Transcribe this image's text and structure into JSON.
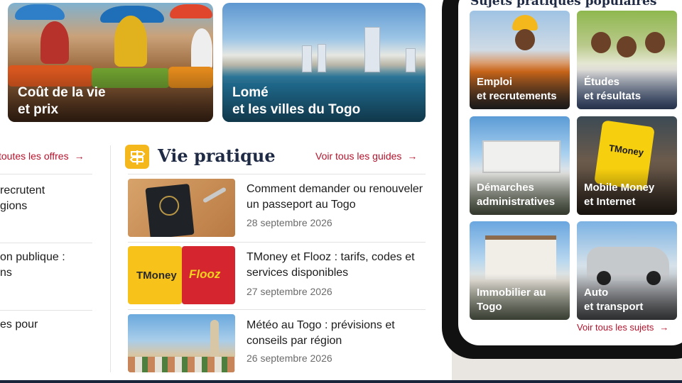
{
  "hero": {
    "market_title_line1": "Coût de la vie",
    "market_title_line2": "et prix",
    "lome_title_line1": "Lomé",
    "lome_title_line2": "et les villes du Togo"
  },
  "left_column": {
    "link": "toutes les offres",
    "item1_line1": "recrutent",
    "item1_line2": "gions",
    "item2_line1": "on publique :",
    "item2_line2": "ns",
    "item3_line1": "es pour"
  },
  "vie_pratique": {
    "title": "Vie pratique",
    "see_all": "Voir tous les guides",
    "articles": [
      {
        "title": "Comment demander ou renouveler un passeport au Togo",
        "date": "28 septembre 2026"
      },
      {
        "title": "TMoney et Flooz : tarifs, codes et services disponibles",
        "date": "27 septembre 2026"
      },
      {
        "title": "Météo au Togo : prévisions et conseils par région",
        "date": "26 septembre 2026"
      }
    ],
    "thumb_tmoney": "TMoney",
    "thumb_flooz": "Flooz"
  },
  "phone": {
    "heading": "Sujets pratiques populaires",
    "tiles": [
      {
        "line1": "Emploi",
        "line2": "et recrutements"
      },
      {
        "line1": "Études",
        "line2": "et résultats"
      },
      {
        "line1": "Démarches",
        "line2": "administratives"
      },
      {
        "line1": "Mobile Money",
        "line2": "et Internet"
      },
      {
        "line1": "Immobilier au Togo",
        "line2": ""
      },
      {
        "line1": "Auto",
        "line2": "et transport"
      }
    ],
    "mobile_screen_text": "TMoney",
    "see_all": "Voir tous les sujets"
  },
  "colors": {
    "accent_red": "#b4132c",
    "navy": "#1f2a44",
    "yellow": "#f5b81c"
  },
  "icons": {
    "vie_pratique": "signpost-icon",
    "arrow": "arrow-right-icon"
  }
}
